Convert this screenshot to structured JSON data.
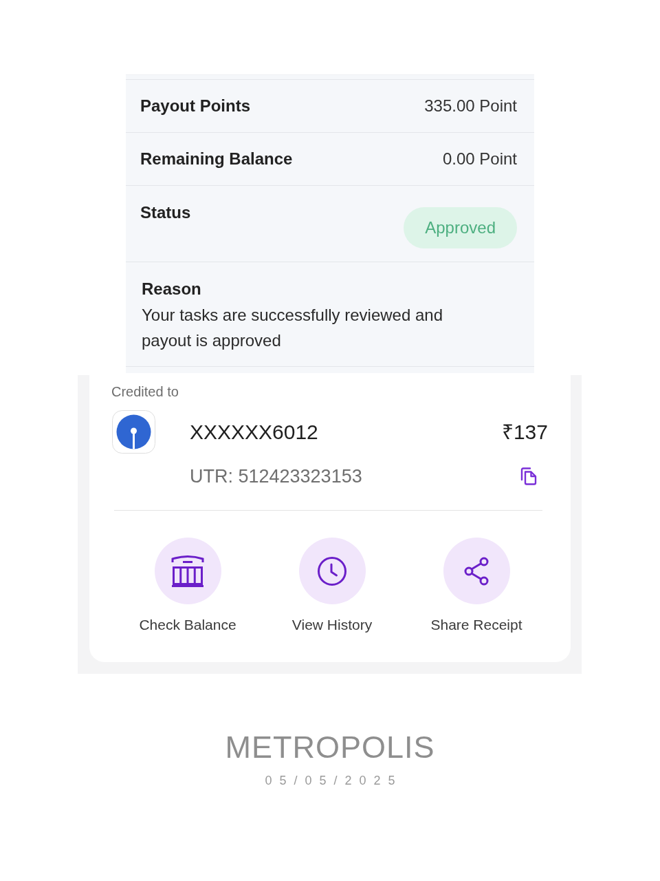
{
  "details": {
    "rows": [
      {
        "kind": "value",
        "label": "Payout Points",
        "value": "335.00 Point"
      },
      {
        "kind": "value",
        "label": "Remaining Balance",
        "value": "0.00 Point"
      },
      {
        "kind": "status",
        "label": "Status",
        "value": "Approved"
      },
      {
        "kind": "note",
        "label": "Reason",
        "value": "Your tasks are successfully reviewed and payout is approved"
      }
    ]
  },
  "credit": {
    "heading": "Credited to",
    "account": "XXXXXX6012",
    "amount": "₹137",
    "utr": "UTR: 512423323153",
    "actions": [
      {
        "label": "Check Balance"
      },
      {
        "label": "View History"
      },
      {
        "label": "Share Receipt"
      }
    ]
  },
  "caption": {
    "title": "METROPOLIS",
    "date": "05/05/2025"
  }
}
